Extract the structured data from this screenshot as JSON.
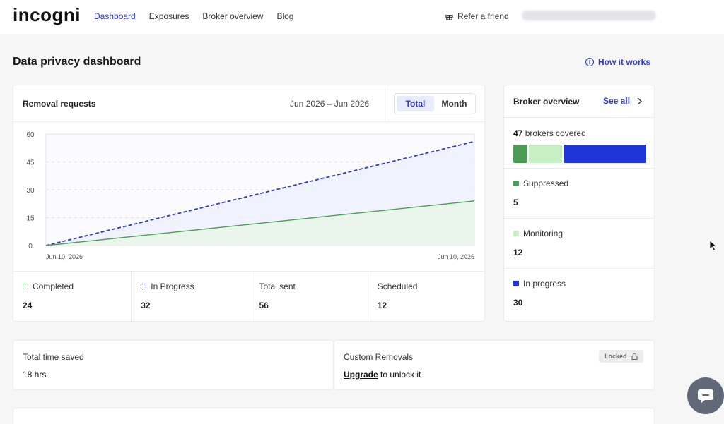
{
  "nav": {
    "logo": "incogni",
    "links": [
      "Dashboard",
      "Exposures",
      "Broker overview",
      "Blog"
    ],
    "refer": "Refer a friend"
  },
  "page": {
    "title": "Data privacy dashboard",
    "how_it_works": "How it works"
  },
  "removal": {
    "title": "Removal requests",
    "range": "Jun 2026 – Jun 2026",
    "toggle": [
      "Total",
      "Month"
    ],
    "stats": [
      {
        "label": "Completed",
        "value": "24"
      },
      {
        "label": "In Progress",
        "value": "32"
      },
      {
        "label": "Total sent",
        "value": "56"
      },
      {
        "label": "Scheduled",
        "value": "12"
      }
    ]
  },
  "chart_data": {
    "type": "line",
    "x": [
      "Jun 10, 2026",
      "Jun 10, 2026"
    ],
    "ylim": [
      0,
      60
    ],
    "yticks": [
      0,
      15,
      30,
      45,
      60
    ],
    "series": [
      {
        "name": "In Progress",
        "values": [
          0,
          56
        ],
        "color": "#2f3ac9",
        "style": "dashed"
      },
      {
        "name": "Completed",
        "values": [
          0,
          24
        ],
        "color": "#4c9c55",
        "style": "solid"
      }
    ]
  },
  "broker": {
    "title": "Broker overview",
    "see_all": "See all",
    "covered_count": "47",
    "covered_text": "brokers covered",
    "rows": [
      {
        "label": "Suppressed",
        "value": "5",
        "color": "#4c9c55"
      },
      {
        "label": "Monitoring",
        "value": "12",
        "color": "#c6efc4"
      },
      {
        "label": "In progress",
        "value": "30",
        "color": "#1f35d6"
      }
    ]
  },
  "saved": {
    "label": "Total time saved",
    "value": "18 hrs"
  },
  "custom": {
    "label": "Custom Removals",
    "badge": "Locked",
    "upgrade": "Upgrade",
    "rest": "to unlock it"
  }
}
